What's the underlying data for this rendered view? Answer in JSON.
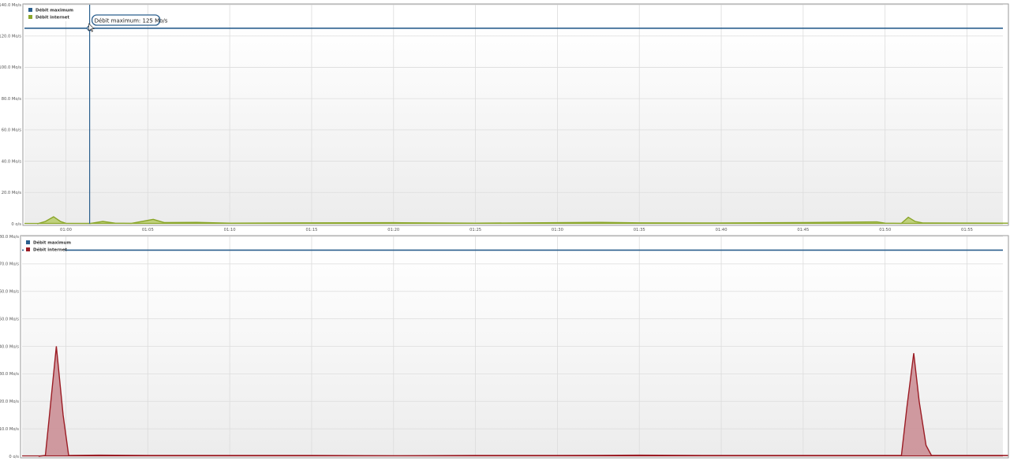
{
  "colors": {
    "max_line": "#2b5f8e",
    "inbound_line": "#8aa62a",
    "inbound_fill": "#b9cc6a",
    "outbound_line": "#9b1c24",
    "outbound_fill": "#c98a90",
    "grid": "#dcdcdc"
  },
  "legend": {
    "max_label": "Débit maximum",
    "internet_label": "Débit internet"
  },
  "tooltip": {
    "text": "Débit maximum: 125 Mo/s"
  },
  "x_axis": {
    "tick_labels": [
      "01:00",
      "01:05",
      "01:10",
      "01:15",
      "01:20",
      "01:25",
      "01:30",
      "01:35",
      "01:40",
      "01:45",
      "01:50",
      "01:55"
    ]
  },
  "chart_data": [
    {
      "type": "area",
      "unit": "Mo/s",
      "x_unit": "time (hh:mm)",
      "ylim": [
        0,
        140
      ],
      "y_ticks": [
        "0 o/s",
        "20.0 Mo/s",
        "40.0 Mo/s",
        "60.0 Mo/s",
        "80.0 Mo/s",
        "100.0 Mo/s",
        "120.0 Mo/s",
        "140.0 Mo/s"
      ],
      "grid": true,
      "legend_position": "top-left",
      "series": [
        {
          "name": "Débit maximum",
          "style": "line",
          "constant": 125
        },
        {
          "name": "Débit internet",
          "style": "area",
          "points": [
            [
              "00:58:15",
              0
            ],
            [
              "00:58:45",
              1.5
            ],
            [
              "00:59:15",
              4.5
            ],
            [
              "00:59:40",
              1.5
            ],
            [
              "01:00:00",
              0.3
            ],
            [
              "01:01:30",
              0.2
            ],
            [
              "01:02:15",
              1.5
            ],
            [
              "01:03:00",
              0.4
            ],
            [
              "01:04:00",
              0.3
            ],
            [
              "01:05:20",
              2.8
            ],
            [
              "01:06:00",
              0.8
            ],
            [
              "01:08:00",
              0.9
            ],
            [
              "01:10:00",
              0.4
            ],
            [
              "01:15:00",
              0.6
            ],
            [
              "01:20:00",
              0.7
            ],
            [
              "01:25:00",
              0.4
            ],
            [
              "01:30:00",
              0.7
            ],
            [
              "01:32:30",
              0.9
            ],
            [
              "01:35:00",
              0.6
            ],
            [
              "01:40:00",
              0.5
            ],
            [
              "01:45:00",
              0.8
            ],
            [
              "01:49:30",
              1.2
            ],
            [
              "01:50:00",
              0.4
            ],
            [
              "01:51:00",
              0.3
            ],
            [
              "01:51:25",
              4.2
            ],
            [
              "01:51:50",
              1.5
            ],
            [
              "01:52:20",
              0.5
            ],
            [
              "01:57:30",
              0.4
            ]
          ]
        }
      ]
    },
    {
      "type": "area",
      "unit": "Mo/s",
      "x_unit": "time (hh:mm)",
      "ylim": [
        0,
        80
      ],
      "y_ticks": [
        "0 o/s",
        "10.0 Mo/s",
        "20.0 Mo/s",
        "30.0 Mo/s",
        "40.0 Mo/s",
        "50.0 Mo/s",
        "60.0 Mo/s",
        "70.0 Mo/s",
        "80.0 Mo/s"
      ],
      "grid": true,
      "legend_position": "top-left",
      "series": [
        {
          "name": "Débit maximum",
          "style": "line",
          "constant": 75
        },
        {
          "name": "Débit internet",
          "style": "area",
          "points": [
            [
              "00:58:20",
              0
            ],
            [
              "00:58:45",
              0.3
            ],
            [
              "00:59:00",
              15
            ],
            [
              "00:59:25",
              40
            ],
            [
              "00:59:50",
              15
            ],
            [
              "01:00:10",
              0.3
            ],
            [
              "01:02:00",
              0.4
            ],
            [
              "01:05:00",
              0.3
            ],
            [
              "01:10:00",
              0.3
            ],
            [
              "01:15:00",
              0.3
            ],
            [
              "01:20:00",
              0.2
            ],
            [
              "01:25:00",
              0.3
            ],
            [
              "01:30:00",
              0.3
            ],
            [
              "01:35:00",
              0.4
            ],
            [
              "01:40:00",
              0.3
            ],
            [
              "01:45:00",
              0.3
            ],
            [
              "01:50:00",
              0.3
            ],
            [
              "01:51:00",
              0.3
            ],
            [
              "01:51:20",
              18
            ],
            [
              "01:51:45",
              37.5
            ],
            [
              "01:52:05",
              20
            ],
            [
              "01:52:30",
              4
            ],
            [
              "01:52:50",
              0.3
            ],
            [
              "01:57:30",
              0.3
            ]
          ]
        }
      ]
    }
  ]
}
